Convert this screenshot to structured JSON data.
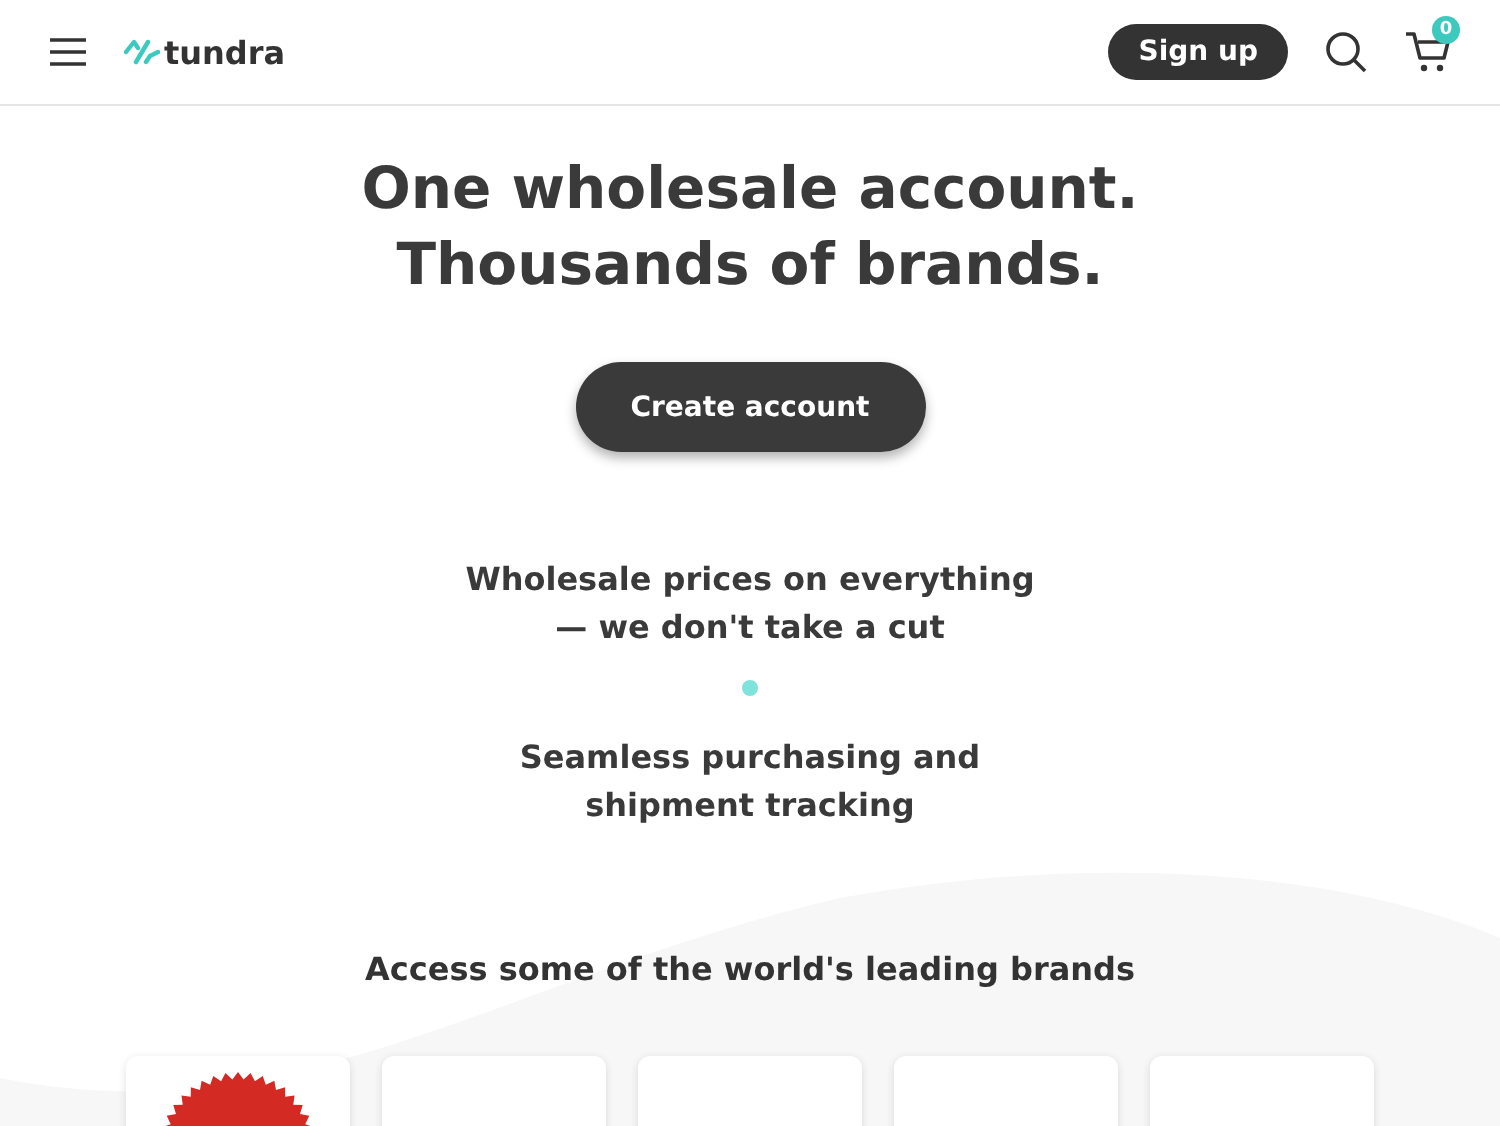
{
  "header": {
    "logo": "tundra",
    "signup": "Sign up",
    "cart_count": "0"
  },
  "hero": {
    "title_lines": [
      "One wholesale account.",
      "Thousands of brands."
    ],
    "cta": "Create account"
  },
  "features": [
    "Wholesale prices on everything — we don't take a cut",
    "Seamless purchasing and shipment tracking"
  ],
  "brands": {
    "heading": "Access some of the world's leading brands",
    "cards": [
      {
        "kind": "seal"
      },
      {
        "kind": "blank"
      },
      {
        "kind": "blank"
      },
      {
        "kind": "blank"
      },
      {
        "kind": "blank"
      }
    ]
  }
}
